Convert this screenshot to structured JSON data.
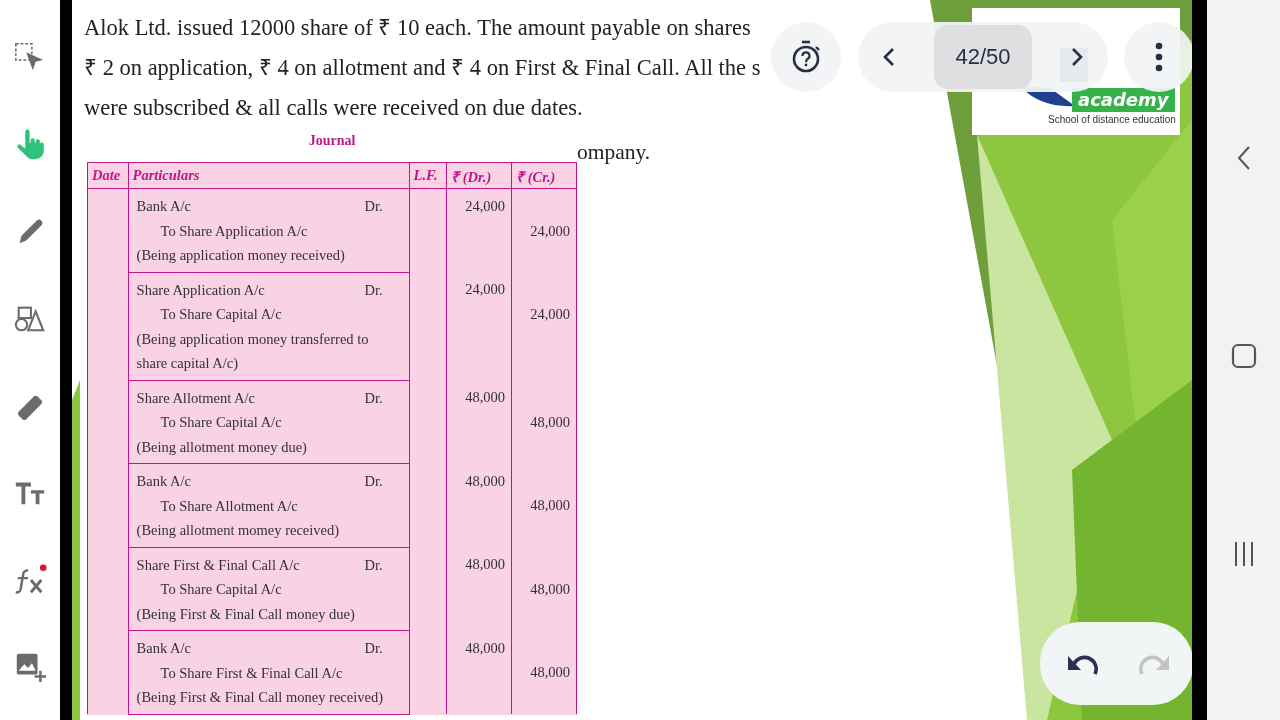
{
  "toolbar": {
    "tools": [
      {
        "kind": "select",
        "selected": false,
        "badge": false
      },
      {
        "kind": "hand",
        "selected": true,
        "badge": false
      },
      {
        "kind": "pen",
        "selected": false,
        "badge": false
      },
      {
        "kind": "shapes",
        "selected": false,
        "badge": false
      },
      {
        "kind": "eraser",
        "selected": false,
        "badge": false
      },
      {
        "kind": "text",
        "selected": false,
        "badge": false
      },
      {
        "kind": "formula",
        "selected": false,
        "badge": true
      },
      {
        "kind": "image",
        "selected": false,
        "badge": false
      }
    ]
  },
  "document": {
    "paragraph_lines": [
      "Alok Ltd. issued 12000 share of ₹ 10 each. The amount payable on shares",
      "₹ 2 on application, ₹ 4 on allotment and ₹ 4 on First & Final Call. All the s",
      "were subscribed & all calls were received on due dates."
    ],
    "side_text": "ompany.",
    "journal": {
      "title": "Journal",
      "columns": [
        "Date",
        "Particulars",
        "L.F.",
        "₹ (Dr.)",
        "₹ (Cr.)"
      ],
      "rows": [
        {
          "debit": "Bank A/c",
          "dr_mark": "Dr.",
          "credit": "To Share Application A/c",
          "narration": "(Being application money received)",
          "debit_amount": "24,000",
          "credit_amount": "24,000"
        },
        {
          "debit": "Share Application A/c",
          "dr_mark": "Dr.",
          "credit": "To Share Capital A/c",
          "narration": "(Being application money transferred to share capital A/c)",
          "debit_amount": "24,000",
          "credit_amount": "24,000"
        },
        {
          "debit": "Share Allotment A/c",
          "dr_mark": "Dr.",
          "credit": "To Share Capital A/c",
          "narration": "(Being allotment money due)",
          "debit_amount": "48,000",
          "credit_amount": "48,000"
        },
        {
          "debit": "Bank A/c",
          "dr_mark": "Dr.",
          "credit": "To Share Allotment A/c",
          "narration": "(Being allotment momey received)",
          "debit_amount": "48,000",
          "credit_amount": "48,000"
        },
        {
          "debit": "Share First & Final Call A/c",
          "dr_mark": "Dr.",
          "credit": "To Share Capital A/c",
          "narration": "(Being First & Final Call money due)",
          "debit_amount": "48,000",
          "credit_amount": "48,000"
        },
        {
          "debit": "Bank A/c",
          "dr_mark": "Dr.",
          "credit": "To Share First & Final Call A/c",
          "narration": "(Being First & Final Call money received)",
          "debit_amount": "48,000",
          "credit_amount": "48,000"
        }
      ]
    },
    "logo": {
      "badge": "academy",
      "tagline": "School of distance education"
    }
  },
  "viewer_controls": {
    "page_counter": "42/50"
  },
  "history": [
    {
      "kind": "undo",
      "disabled": false
    },
    {
      "kind": "redo",
      "disabled": true
    }
  ],
  "navigation_bar": {
    "buttons": [
      {
        "kind": "back"
      },
      {
        "kind": "home"
      },
      {
        "kind": "recents"
      }
    ]
  }
}
